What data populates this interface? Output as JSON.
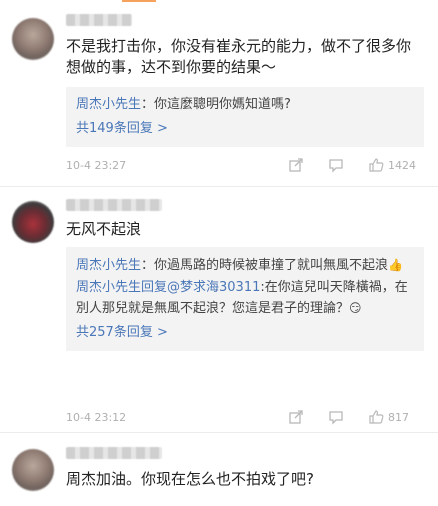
{
  "comments": [
    {
      "content": "不是我打击你，你没有崔永元的能力，做不了很多你想做的事，达不到你要的结果～",
      "reply": {
        "name": "周杰小先生",
        "text": "：你這麼聰明你媽知道嗎?",
        "more": "共149条回复 >"
      },
      "meta": {
        "time": "10-4 23:27",
        "likes": "1424"
      }
    },
    {
      "content": "无风不起浪",
      "reply": {
        "line1_name": "周杰小先生",
        "line1_text": "：你過馬路的時候被車撞了就叫無風不起浪",
        "line1_emoji": "👍",
        "line2_name": "周杰小先生回复@梦求海30311",
        "line2_text": ":在你這兒叫天降橫禍，在別人那兒就是無風不起浪？您這是君子的理論？",
        "line2_emoji": "😏",
        "more": "共257条回复 >"
      },
      "meta": {
        "time": "10-4 23:12",
        "likes": "817"
      }
    },
    {
      "content": "周杰加油。你现在怎么也不拍戏了吧?"
    }
  ],
  "icons": [
    "share-icon",
    "comment-icon",
    "thumbs-up-icon"
  ],
  "colors": {
    "link": "#4a77b8",
    "meta": "#b0b0b0",
    "reply_bg": "#f3f3f3",
    "accent": "#f5a25d"
  }
}
